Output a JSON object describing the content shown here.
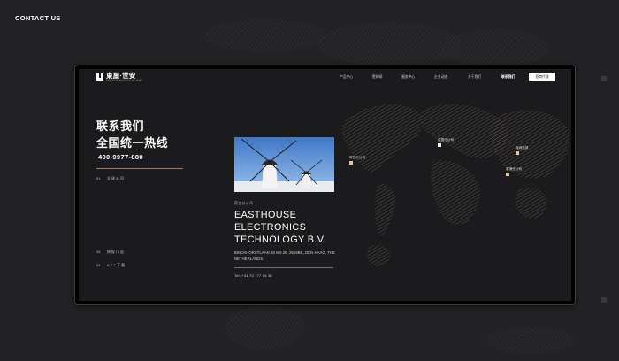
{
  "page": {
    "title": "CONTACT US"
  },
  "logo": {
    "name": "東屋·世安",
    "subtitle": "EASTHOUSE ELECTRONICS · SHIAN"
  },
  "nav": {
    "items": [
      {
        "label": "产品中心",
        "active": false
      },
      {
        "label": "壁炉网",
        "active": false
      },
      {
        "label": "服务中心",
        "active": false
      },
      {
        "label": "企业动态",
        "active": false
      },
      {
        "label": "关于我们",
        "active": false
      },
      {
        "label": "联系我们",
        "active": true
      }
    ],
    "button_label": "招商代理"
  },
  "hero": {
    "heading_line1": "联系我们",
    "heading_line2": "全国统一热线",
    "hotline": "400-9977-880"
  },
  "tabs": [
    {
      "num": "01.",
      "label": "全球公司"
    },
    {
      "num": "02.",
      "label": "授权门店"
    },
    {
      "num": "03.",
      "label": "APP下载"
    }
  ],
  "office": {
    "branch_label": "荷兰分公司",
    "company_name": "EASTHOUSE ELECTRONICS TECHNOLOGY B.V",
    "address": "BINCKHORSTLAAN 36 M4-20, 2516BE, DEN HAAG, THE NETHERLANDS",
    "tel": "Tel:  +31 70 777 06 36"
  },
  "markers": [
    {
      "label": "荷兰分公司",
      "style": "tan"
    },
    {
      "label": "英国分公司",
      "style": "white"
    },
    {
      "label": "深圳总部",
      "style": "tan"
    },
    {
      "label": "香港分公司",
      "style": "tan"
    }
  ],
  "colors": {
    "background": "#222224",
    "screen": "#1b1b1d",
    "accent": "#9b7a5a",
    "marker_tan": "#e2c7a6"
  },
  "icons": {
    "logo": "house-logo-icon",
    "photo": "windmill-photo"
  }
}
